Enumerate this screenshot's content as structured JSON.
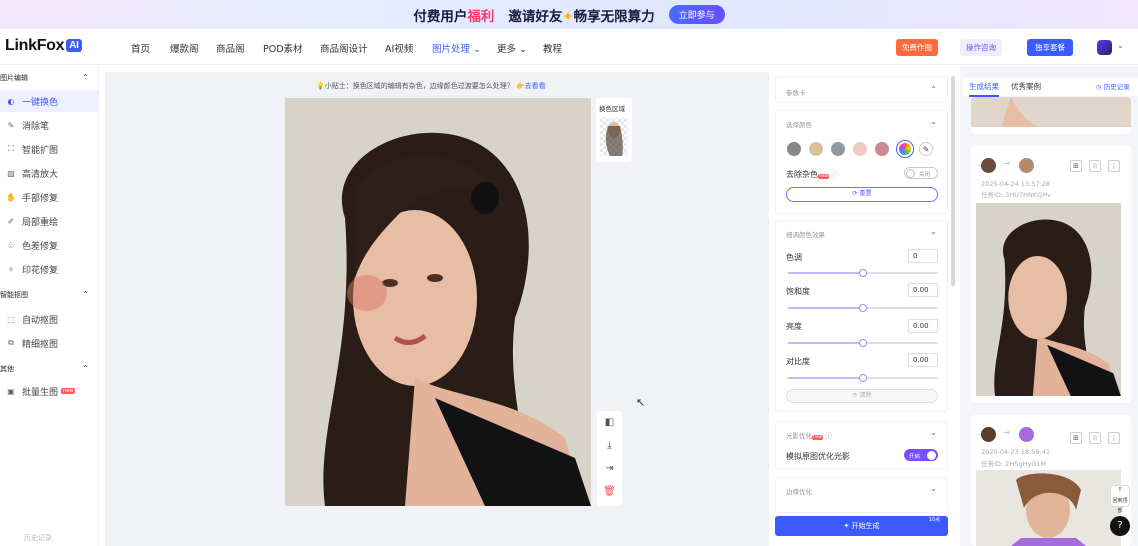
{
  "banner": {
    "part1": "付费用户",
    "part1_hl": "福利",
    "part2": "邀请好友",
    "part3": "畅享无限算力",
    "cta": "立即参与"
  },
  "nav": {
    "logo": "LinkFox",
    "logo_badge": "AI",
    "items": [
      "首页",
      "爆款阁",
      "商品阁",
      "POD素材",
      "商品阁设计",
      "AI视频",
      "图片处理",
      "更多",
      "教程"
    ],
    "free_btn": "免费作图",
    "consult_btn": "操作咨询",
    "package_btn": "独享套餐"
  },
  "sidebar": {
    "groups": [
      {
        "title": "图片编辑",
        "items": [
          {
            "label": "一键换色",
            "icon": "color-icon"
          },
          {
            "label": "消除笔",
            "icon": "eraser-icon"
          },
          {
            "label": "智能扩图",
            "icon": "expand-icon"
          },
          {
            "label": "高清放大",
            "icon": "upscale-icon"
          },
          {
            "label": "手部修复",
            "icon": "hand-icon"
          },
          {
            "label": "局部重绘",
            "icon": "brush-icon"
          },
          {
            "label": "色差修复",
            "icon": "palette-icon"
          },
          {
            "label": "印花修复",
            "icon": "print-icon"
          }
        ]
      },
      {
        "title": "智能抠图",
        "items": [
          {
            "label": "自动抠图",
            "icon": "cutout-icon"
          },
          {
            "label": "精细抠图",
            "icon": "fine-cutout-icon"
          }
        ]
      },
      {
        "title": "其他",
        "items": [
          {
            "label": "批量生图",
            "icon": "batch-icon",
            "badge": "new"
          }
        ]
      }
    ],
    "footer": "历史记录"
  },
  "canvas": {
    "tip": "小贴士：换色区域的编辑有杂色，边缘颜色过渡要怎么处理？",
    "tip_link": "去看看",
    "swatch_area_label": "换色区域",
    "watermark": "LinkFox"
  },
  "settings": {
    "section1_title": "参数卡",
    "color_section_title": "选择颜色",
    "swatches": [
      "#888888",
      "#d8bf9e",
      "#8c9aa2",
      "#f2c8c0",
      "#c98a92"
    ],
    "remove_noise_label": "去除杂色",
    "remove_noise_toggle": "关闭",
    "reset_btn": "重置",
    "adjust_title": "细调颜色效果",
    "sliders": [
      {
        "label": "色调",
        "value": "0",
        "fraction": 0.5
      },
      {
        "label": "饱和度",
        "value": "0.00",
        "fraction": 0.5
      },
      {
        "label": "亮度",
        "value": "0.00",
        "fraction": 0.5
      },
      {
        "label": "对比度",
        "value": "0.00",
        "fraction": 0.5
      }
    ],
    "clear_btn": "清除",
    "optimize_title": "光影优化",
    "optimize_badge": "new",
    "optimize_label": "模拟原图优化光影",
    "optimize_toggle": "开启",
    "section4_title": "边缘优化",
    "generate_btn": "开始生成",
    "generate_cost": "10点"
  },
  "results": {
    "tab_active": "生成结果",
    "tab_other": "优秀案例",
    "history": "历史记录",
    "cards": [
      {
        "date": "2025-04-24 13:57:28",
        "id": "任务ID: 3HU7HNKQHv",
        "chip_color": "#b08a6a"
      },
      {
        "date": "2025-04-23 18:59:41",
        "id": "任务ID: 2HSgHyG1M",
        "chip_color": "#a46bdc"
      }
    ]
  },
  "help": {
    "top": "回到顶部",
    "qmark": "?"
  }
}
